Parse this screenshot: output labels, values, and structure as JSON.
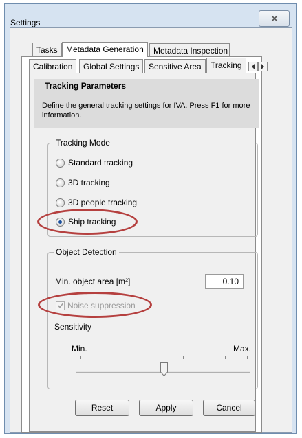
{
  "window": {
    "title": "Settings"
  },
  "tabs": [
    "Tasks",
    "Metadata Generation",
    "Metadata Inspection"
  ],
  "subtabs": [
    "Calibration",
    "Global Settings",
    "Sensitive Area",
    "Tracking"
  ],
  "header": {
    "title": "Tracking Parameters",
    "description": "Define the general tracking settings for IVA. Press F1 for more information."
  },
  "tracking_mode": {
    "label": "Tracking Mode",
    "options": [
      "Standard tracking",
      "3D tracking",
      "3D people tracking",
      "Ship tracking"
    ],
    "selected": "Ship tracking"
  },
  "object_detection": {
    "label": "Object Detection",
    "min_area_label": "Min. object area [m²]",
    "min_area_value": "0.10",
    "noise_label": "Noise suppression",
    "noise_checked": true,
    "sensitivity_label": "Sensitivity",
    "min_label": "Min.",
    "max_label": "Max.",
    "sensitivity_level": 0.5
  },
  "buttons": {
    "reset": "Reset",
    "apply": "Apply",
    "cancel": "Cancel"
  },
  "colors": {
    "highlight_ellipse": "#b5403f",
    "header_bg": "#dcdcdc"
  }
}
